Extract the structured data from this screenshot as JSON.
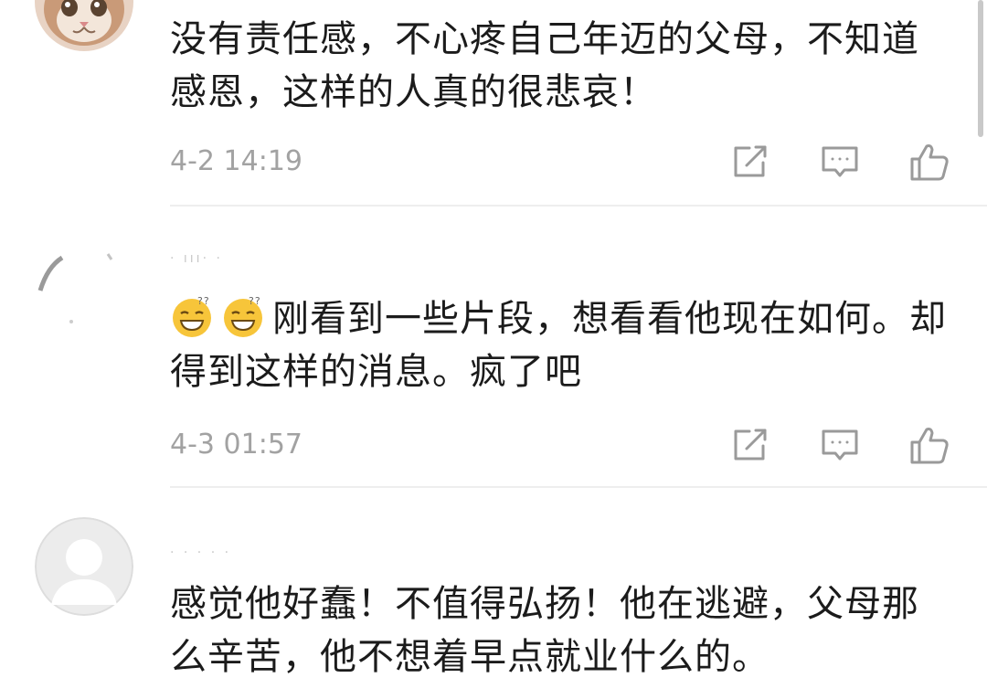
{
  "comments": [
    {
      "username": "",
      "text": "没有责任感，不心疼自己年迈的父母，不知道感恩，这样的人真的很悲哀！",
      "time": "4-2 14:19",
      "avatar": "cat-avatar"
    },
    {
      "username": "· ııı· ·",
      "emojis": [
        "dizzy-grin-emoji",
        "dizzy-grin-emoji"
      ],
      "text": "刚看到一些片段，想看看他现在如何。却得到这样的消息。疯了吧",
      "time": "4-3 01:57",
      "avatar": "blurred-avatar"
    },
    {
      "username": "· · ·  ·  ·",
      "text": "感觉他好蠢！不值得弘扬！他在逃避，父母那么辛苦，他不想着早点就业什么的。",
      "avatar": "default-person-avatar"
    }
  ],
  "actions": [
    "share-icon",
    "reply-icon",
    "like-icon"
  ],
  "colors": {
    "text": "#1b1b1b",
    "meta": "#a2a2a2",
    "icon": "#9a9a9a",
    "divider": "#eeeeee"
  }
}
